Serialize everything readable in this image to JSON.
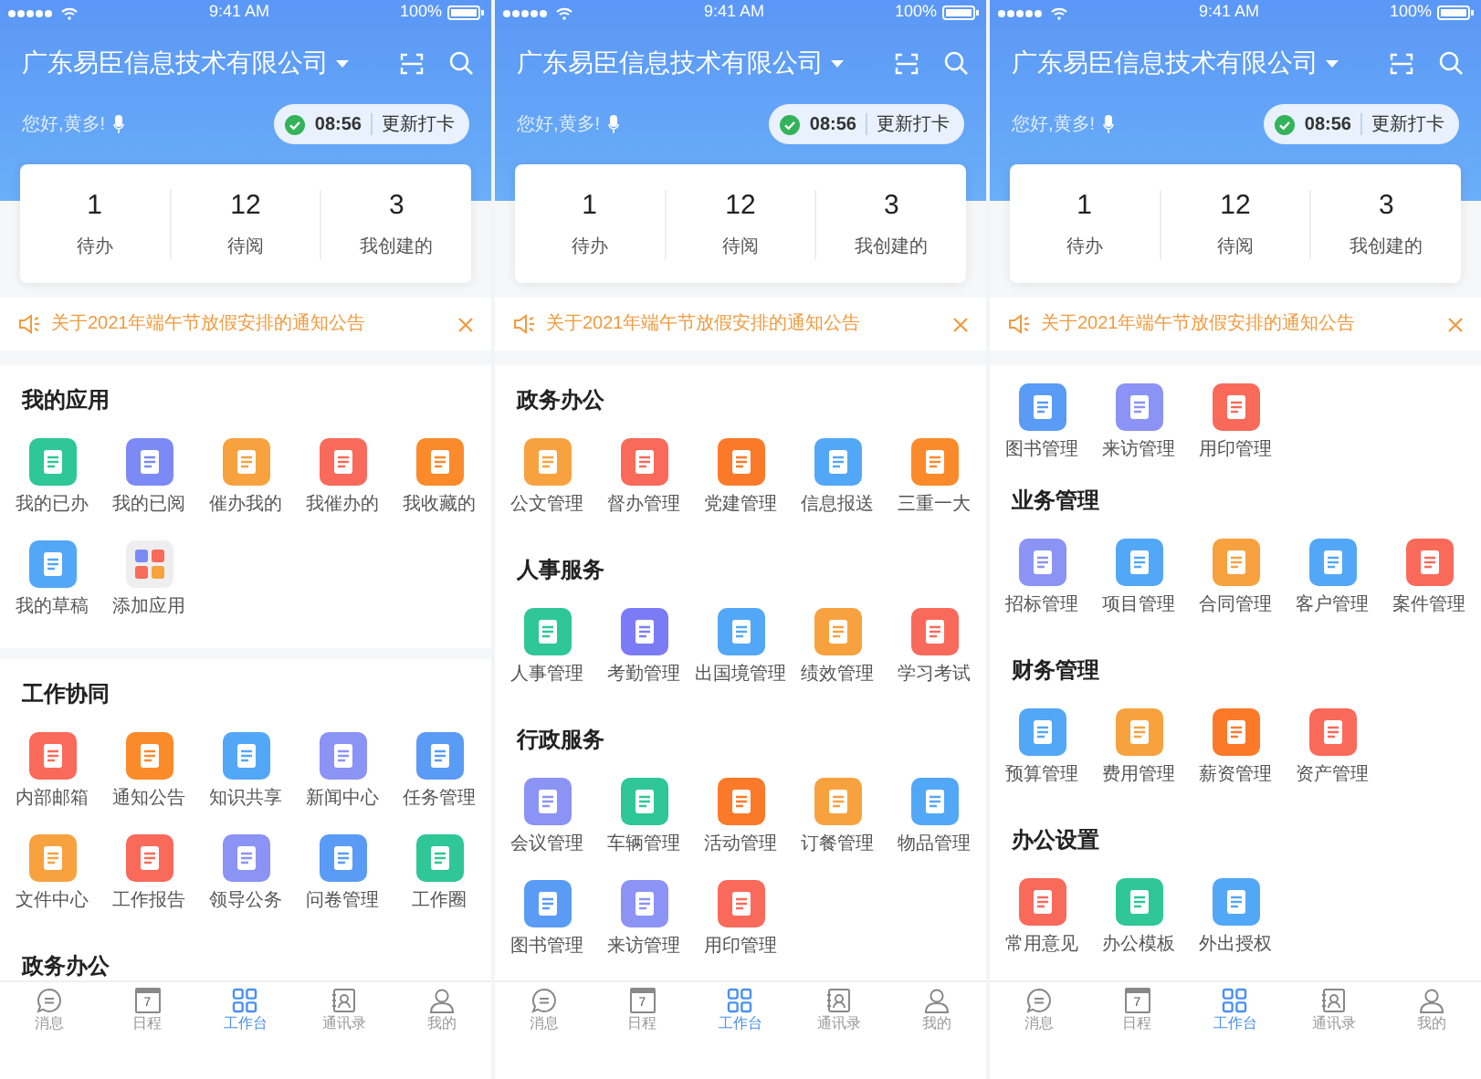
{
  "phones": [
    {
      "status_bar": {
        "time": "9:41 AM",
        "battery": "100%"
      },
      "company": "广东易臣信息技术有限公司",
      "greeting": "您好,黄多!",
      "clock_in": {
        "time": "08:56",
        "action": "更新打卡"
      },
      "stats": [
        {
          "value": "1",
          "label": "待办"
        },
        {
          "value": "12",
          "label": "待阅"
        },
        {
          "value": "3",
          "label": "我创建的"
        }
      ],
      "notice": "关于2021年端午节放假安排的通知公告",
      "sections": [
        {
          "title": "我的应用",
          "separated": true,
          "apps": [
            {
              "label": "我的已办",
              "color": "#2ec795"
            },
            {
              "label": "我的已阅",
              "color": "#7b8af5"
            },
            {
              "label": "催办我的",
              "color": "#f7a23e"
            },
            {
              "label": "我催办的",
              "color": "#f96a5a"
            },
            {
              "label": "我收藏的",
              "color": "#fb8a2a"
            },
            {
              "label": "我的草稿",
              "color": "#53a7f7"
            },
            {
              "label": "添加应用",
              "kind": "grid"
            }
          ]
        },
        {
          "title": "工作协同",
          "apps": [
            {
              "label": "内部邮箱",
              "color": "#f96a5a"
            },
            {
              "label": "通知公告",
              "color": "#fb8a2a"
            },
            {
              "label": "知识共享",
              "color": "#53a7f7"
            },
            {
              "label": "新闻中心",
              "color": "#8b93f5"
            },
            {
              "label": "任务管理",
              "color": "#5a9bf6"
            },
            {
              "label": "文件中心",
              "color": "#f7a23e"
            },
            {
              "label": "工作报告",
              "color": "#f96a5a"
            },
            {
              "label": "领导公务",
              "color": "#8b93f5"
            },
            {
              "label": "问卷管理",
              "color": "#5a9bf6"
            },
            {
              "label": "工作圈",
              "color": "#2ec795"
            }
          ]
        },
        {
          "title": "政务办公"
        }
      ],
      "tabs": [
        {
          "label": "消息",
          "kind": "message",
          "selected": false
        },
        {
          "label": "日程",
          "kind": "calendar",
          "day": "7",
          "selected": false
        },
        {
          "label": "工作台",
          "kind": "grid",
          "selected": true
        },
        {
          "label": "通讯录",
          "kind": "contacts",
          "selected": false
        },
        {
          "label": "我的",
          "kind": "person",
          "selected": false
        }
      ]
    },
    {
      "status_bar": {
        "time": "9:41 AM",
        "battery": "100%"
      },
      "company": "广东易臣信息技术有限公司",
      "greeting": "您好,黄多!",
      "clock_in": {
        "time": "08:56",
        "action": "更新打卡"
      },
      "stats": [
        {
          "value": "1",
          "label": "待办"
        },
        {
          "value": "12",
          "label": "待阅"
        },
        {
          "value": "3",
          "label": "我创建的"
        }
      ],
      "notice": "关于2021年端午节放假安排的通知公告",
      "sections": [
        {
          "title": "政务办公",
          "apps": [
            {
              "label": "公文管理",
              "color": "#f7a23e"
            },
            {
              "label": "督办管理",
              "color": "#f96a5a"
            },
            {
              "label": "党建管理",
              "color": "#fb7a2a"
            },
            {
              "label": "信息报送",
              "color": "#53a7f7"
            },
            {
              "label": "三重一大",
              "color": "#fb8a2a"
            }
          ]
        },
        {
          "title": "人事服务",
          "apps": [
            {
              "label": "人事管理",
              "color": "#2ec795"
            },
            {
              "label": "考勤管理",
              "color": "#7b7cf5"
            },
            {
              "label": "出国境管理",
              "color": "#53a7f7"
            },
            {
              "label": "绩效管理",
              "color": "#f7a23e"
            },
            {
              "label": "学习考试",
              "color": "#f96a5a"
            }
          ]
        },
        {
          "title": "行政服务",
          "apps": [
            {
              "label": "会议管理",
              "color": "#8b93f5"
            },
            {
              "label": "车辆管理",
              "color": "#2ec795"
            },
            {
              "label": "活动管理",
              "color": "#fb7a2a"
            },
            {
              "label": "订餐管理",
              "color": "#f7a23e"
            },
            {
              "label": "物品管理",
              "color": "#53a7f7"
            },
            {
              "label": "图书管理",
              "color": "#5a9bf6"
            },
            {
              "label": "来访管理",
              "color": "#8b93f5"
            },
            {
              "label": "用印管理",
              "color": "#f96a5a"
            }
          ]
        }
      ],
      "tabs": [
        {
          "label": "消息",
          "kind": "message",
          "selected": false
        },
        {
          "label": "日程",
          "kind": "calendar",
          "day": "7",
          "selected": false
        },
        {
          "label": "工作台",
          "kind": "grid",
          "selected": true
        },
        {
          "label": "通讯录",
          "kind": "contacts",
          "selected": false
        },
        {
          "label": "我的",
          "kind": "person",
          "selected": false
        }
      ]
    },
    {
      "status_bar": {
        "time": "9:41 AM",
        "battery": "100%"
      },
      "company": "广东易臣信息技术有限公司",
      "greeting": "您好,黄多!",
      "clock_in": {
        "time": "08:56",
        "action": "更新打卡"
      },
      "stats": [
        {
          "value": "1",
          "label": "待办"
        },
        {
          "value": "12",
          "label": "待阅"
        },
        {
          "value": "3",
          "label": "我创建的"
        }
      ],
      "notice": "关于2021年端午节放假安排的通知公告",
      "sections": [
        {
          "apps": [
            {
              "label": "图书管理",
              "color": "#5a9bf6"
            },
            {
              "label": "来访管理",
              "color": "#8b93f5"
            },
            {
              "label": "用印管理",
              "color": "#f96a5a"
            }
          ]
        },
        {
          "title": "业务管理",
          "apps": [
            {
              "label": "招标管理",
              "color": "#8b93f5"
            },
            {
              "label": "项目管理",
              "color": "#53a7f7"
            },
            {
              "label": "合同管理",
              "color": "#f7a23e"
            },
            {
              "label": "客户管理",
              "color": "#53a7f7"
            },
            {
              "label": "案件管理",
              "color": "#f96a5a"
            }
          ]
        },
        {
          "title": "财务管理",
          "apps": [
            {
              "label": "预算管理",
              "color": "#53a7f7"
            },
            {
              "label": "费用管理",
              "color": "#f7a23e"
            },
            {
              "label": "薪资管理",
              "color": "#fb7a2a"
            },
            {
              "label": "资产管理",
              "color": "#f96a5a"
            }
          ]
        },
        {
          "title": "办公设置",
          "apps": [
            {
              "label": "常用意见",
              "color": "#f96a5a"
            },
            {
              "label": "办公模板",
              "color": "#2ec795"
            },
            {
              "label": "外出授权",
              "color": "#53a7f7"
            }
          ]
        }
      ],
      "tabs": [
        {
          "label": "消息",
          "kind": "message",
          "selected": false
        },
        {
          "label": "日程",
          "kind": "calendar",
          "day": "7",
          "selected": false
        },
        {
          "label": "工作台",
          "kind": "grid",
          "selected": true
        },
        {
          "label": "通讯录",
          "kind": "contacts",
          "selected": false
        },
        {
          "label": "我的",
          "kind": "person",
          "selected": false
        }
      ]
    }
  ]
}
